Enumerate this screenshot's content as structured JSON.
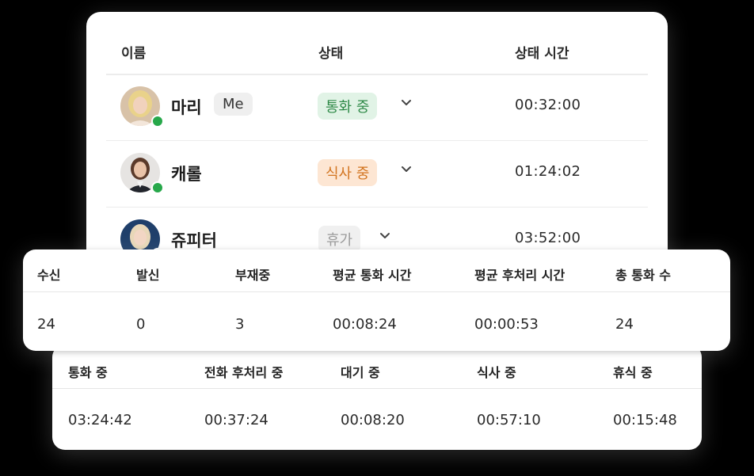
{
  "agents_table": {
    "headers": {
      "name": "이름",
      "status": "상태",
      "status_time": "상태 시간"
    },
    "rows": [
      {
        "name": "마리",
        "badge": "Me",
        "status": "통화 중",
        "status_time": "00:32:00",
        "online": true,
        "status_color": "#e1f3e6",
        "status_text_color": "#2f8a48"
      },
      {
        "name": "캐롤",
        "status": "식사 중",
        "status_time": "01:24:02",
        "online": true,
        "status_color": "#fde6d3",
        "status_text_color": "#d2741f"
      },
      {
        "name": "쥬피터",
        "status": "휴가",
        "status_time": "03:52:00",
        "online": true,
        "status_color": "#f0f0f0",
        "status_text_color": "#9a9a9a"
      }
    ]
  },
  "summary": {
    "headers": [
      "수신",
      "발신",
      "부재중",
      "평균 통화 시간",
      "평균 후처리 시간",
      "총 통화 수"
    ],
    "values": [
      "24",
      "0",
      "3",
      "00:08:24",
      "00:00:53",
      "24"
    ]
  },
  "breakdown": {
    "headers": [
      "통화 중",
      "전화 후처리 중",
      "대기 중",
      "식사 중",
      "휴식 중"
    ],
    "values": [
      "03:24:42",
      "00:37:24",
      "00:08:20",
      "00:57:10",
      "00:15:48"
    ]
  },
  "colors": {
    "online": "#27a84a"
  }
}
